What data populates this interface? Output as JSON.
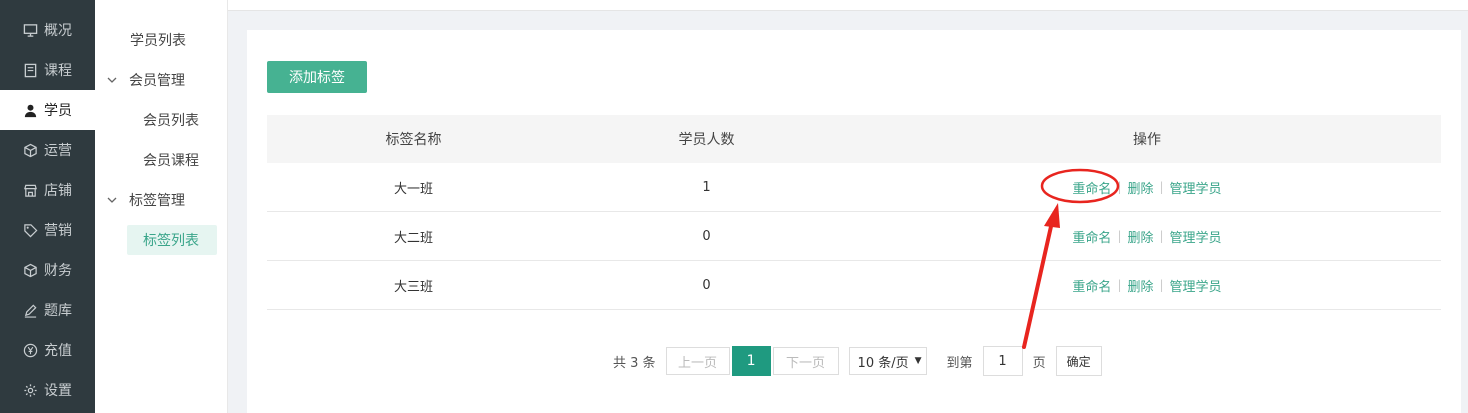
{
  "nav": {
    "items": [
      {
        "label": "概况",
        "icon": "monitor-icon"
      },
      {
        "label": "课程",
        "icon": "book-icon"
      },
      {
        "label": "学员",
        "icon": "user-icon",
        "active": true
      },
      {
        "label": "运营",
        "icon": "cube-icon"
      },
      {
        "label": "店铺",
        "icon": "store-icon"
      },
      {
        "label": "营销",
        "icon": "tag-icon"
      },
      {
        "label": "财务",
        "icon": "cube-icon"
      },
      {
        "label": "题库",
        "icon": "pencil-icon"
      },
      {
        "label": "充值",
        "icon": "yen-icon"
      },
      {
        "label": "设置",
        "icon": "gear-icon"
      }
    ]
  },
  "subnav": {
    "student_list": "学员列表",
    "member_mgmt": "会员管理",
    "member_list": "会员列表",
    "member_course": "会员课程",
    "tag_mgmt": "标签管理",
    "tag_list": "标签列表"
  },
  "main": {
    "add_tag_label": "添加标签",
    "table": {
      "headers": [
        "标签名称",
        "学员人数",
        "操作"
      ],
      "rows": [
        {
          "name": "大一班",
          "count": "1"
        },
        {
          "name": "大二班",
          "count": "0"
        },
        {
          "name": "大三班",
          "count": "0"
        }
      ],
      "ops": {
        "rename": "重命名",
        "delete": "删除",
        "manage": "管理学员",
        "sep": "|"
      }
    },
    "pagination": {
      "total": "共 3 条",
      "prev": "上一页",
      "current": "1",
      "next": "下一页",
      "page_size": "10 条/页",
      "goto": "到第",
      "goto_value": "1",
      "page_unit": "页",
      "confirm": "确定"
    }
  },
  "colors": {
    "accent": "#46b292",
    "nav_bg": "#2f3a3f",
    "annotation": "#e8251f"
  }
}
